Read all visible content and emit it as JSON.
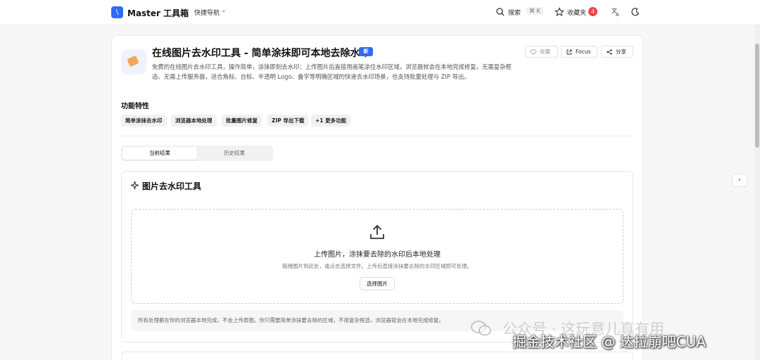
{
  "header": {
    "logo_glyph": "\\",
    "brand": "Master 工具箱",
    "quick_nav": "快捷导航",
    "search_label": "搜索",
    "search_shortcut": "⌘ K",
    "favorites_label": "收藏夹",
    "favorites_count": "4"
  },
  "tool": {
    "title": "在线图片去水印工具 - 简单涂抹即可本地去除水印",
    "badge": "新",
    "description": "免费的在线图片去水印工具，操作简单，涂抹即刻去水印：上传图片后直接用画笔涂住水印区域，浏览器就会在本地完成修复。无需复杂框选、无需上传服务器，适合角标、台标、半透明 Logo、叠字等明确区域的快速去水印场景，也支持批量处理与 ZIP 导出。",
    "actions": {
      "favorite": "收藏",
      "focus": "Focus",
      "share": "分享"
    }
  },
  "features": {
    "heading": "功能特性",
    "items": [
      "简单涂抹去水印",
      "浏览器本地处理",
      "批量图片修复",
      "ZIP 导出下载",
      "+1 更多功能"
    ]
  },
  "tabs": {
    "current": "当前结果",
    "history": "历史结果",
    "active": "current"
  },
  "panel": {
    "title": "图片去水印工具",
    "drop_title": "上传图片，涂抹要去除的水印后本地处理",
    "drop_sub": "拖拽图片到此处，或点击选择文件。上传后直接涂抹要去除的水印区域即可处理。",
    "choose_button": "选择图片",
    "note": "所有处理都在你的浏览器本地完成，不会上传原图。你只需要简单涂抹要去除的区域，不用复杂框选，浏览器就会在本地完成修复。"
  },
  "side_toggle": "‹",
  "watermark": {
    "line1": "公众号 · 这玩意儿真有用",
    "line2": "掘金技术社区 @ 达拉崩吧CUA"
  },
  "colors": {
    "accent": "#2d6cf6",
    "badge_red": "#ef4444"
  }
}
